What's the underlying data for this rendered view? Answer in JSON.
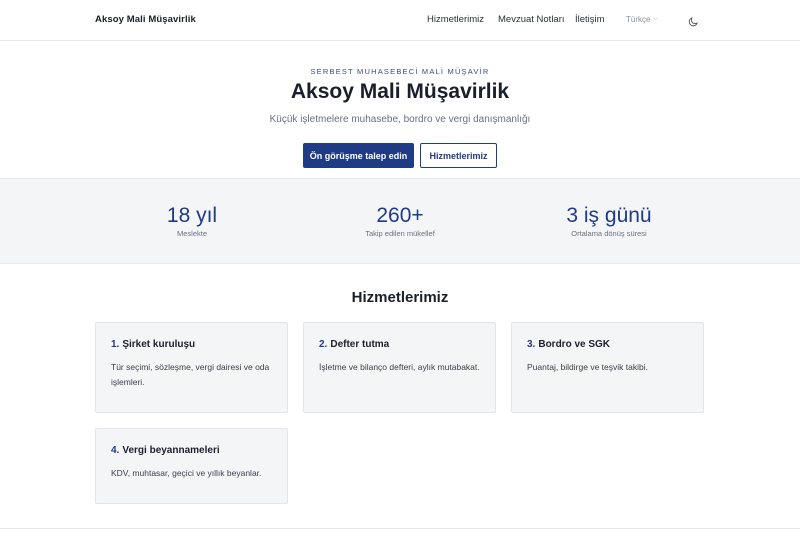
{
  "header": {
    "brand": "Aksoy Mali Müşavirlik",
    "nav": [
      "Hizmetlerimiz",
      "Mevzuat Notları",
      "İletişim"
    ],
    "language": "Türkçe",
    "theme_icon": "moon-icon"
  },
  "hero": {
    "eyebrow": "SERBEST MUHASEBECİ MALİ MÜŞAVİR",
    "title": "Aksoy Mali Müşavirlik",
    "subtitle": "Küçük işletmelere muhasebe, bordro ve vergi danışmanlığı",
    "primary_button": "Ön görüşme talep edin",
    "secondary_button": "Hizmetlerimiz"
  },
  "stats": [
    {
      "value": "18 yıl",
      "label": "Meslekte"
    },
    {
      "value": "260+",
      "label": "Takip edilen mükellef"
    },
    {
      "value": "3 iş günü",
      "label": "Ortalama dönüş süresi"
    }
  ],
  "services": {
    "title": "Hizmetlerimiz",
    "items": [
      {
        "num": "1.",
        "title": "Şirket kuruluşu",
        "desc": "Tür seçimi, sözleşme, vergi dairesi ve oda işlemleri."
      },
      {
        "num": "2.",
        "title": "Defter tutma",
        "desc": "İşletme ve bilanço defteri, aylık mutabakat."
      },
      {
        "num": "3.",
        "title": "Bordro ve SGK",
        "desc": "Puantaj, bildirge ve teşvik takibi."
      },
      {
        "num": "4.",
        "title": "Vergi beyannameleri",
        "desc": "KDV, muhtasar, geçici ve yıllık beyanlar."
      }
    ]
  },
  "colors": {
    "accent": "#1f3b85",
    "band": "#f4f5f7"
  }
}
